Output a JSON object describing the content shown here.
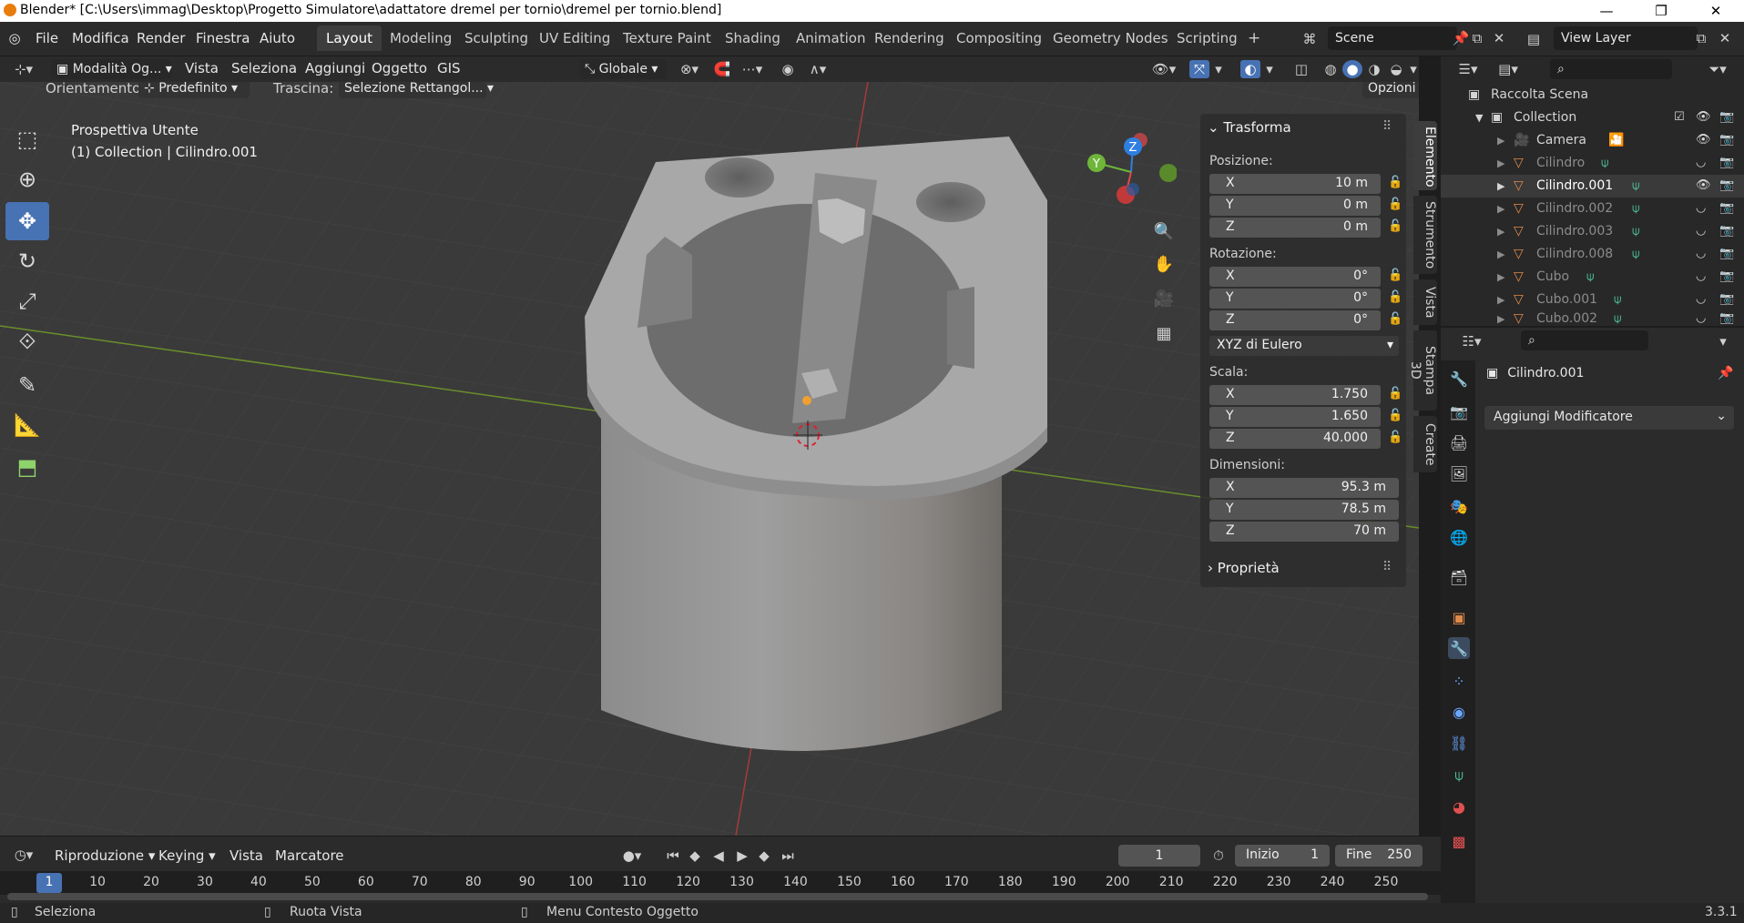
{
  "window": {
    "title": "Blender* [C:\\Users\\immag\\Desktop\\Progetto Simulatore\\adattatore dremel per tornio\\dremel per tornio.blend]",
    "minimize": "—",
    "maximize": "❐",
    "close": "✕"
  },
  "menus": [
    "File",
    "Modifica",
    "Render",
    "Finestra",
    "Aiuto"
  ],
  "workspaces": [
    "Layout",
    "Modeling",
    "Sculpting",
    "UV Editing",
    "Texture Paint",
    "Shading",
    "Animation",
    "Rendering",
    "Compositing",
    "Geometry Nodes",
    "Scripting"
  ],
  "workspace_add": "+",
  "scene": {
    "name": "Scene",
    "view_layer": "View Layer"
  },
  "viewport_header": {
    "mode": "Modalità Og...",
    "items": [
      "Vista",
      "Seleziona",
      "Aggiungi",
      "Oggetto",
      "GIS"
    ],
    "transform_orientation": "Globale"
  },
  "tool_settings": {
    "orient_label": "Orientamento:",
    "orient_value": "Predefinito",
    "drag_label": "Trascina:",
    "drag_value": "Selezione Rettangol...",
    "options": "Opzioni"
  },
  "viewport_info": {
    "line1": "Prospettiva Utente",
    "line2": "(1) Collection | Cilindro.001"
  },
  "gizmo": {
    "x": "X",
    "y": "Y",
    "z": "Z"
  },
  "npanel": {
    "header": "Trasforma",
    "location_label": "Posizione:",
    "location": [
      {
        "axis": "X",
        "value": "10 m"
      },
      {
        "axis": "Y",
        "value": "0 m"
      },
      {
        "axis": "Z",
        "value": "0 m"
      }
    ],
    "rotation_label": "Rotazione:",
    "rotation": [
      {
        "axis": "X",
        "value": "0°"
      },
      {
        "axis": "Y",
        "value": "0°"
      },
      {
        "axis": "Z",
        "value": "0°"
      }
    ],
    "rotation_mode": "XYZ di Eulero",
    "scale_label": "Scala:",
    "scale": [
      {
        "axis": "X",
        "value": "1.750"
      },
      {
        "axis": "Y",
        "value": "1.650"
      },
      {
        "axis": "Z",
        "value": "40.000"
      }
    ],
    "dimensions_label": "Dimensioni:",
    "dimensions": [
      {
        "axis": "X",
        "value": "95.3 m"
      },
      {
        "axis": "Y",
        "value": "78.5 m"
      },
      {
        "axis": "Z",
        "value": "70 m"
      }
    ],
    "properties": "Proprietà"
  },
  "side_tabs": [
    "Elemento",
    "Strumento",
    "Vista",
    "Stampa 3D",
    "Create"
  ],
  "outliner": {
    "root": "Raccolta Scena",
    "collection": "Collection",
    "items": [
      "Camera",
      "Cilindro",
      "Cilindro.001",
      "Cilindro.002",
      "Cilindro.003",
      "Cilindro.008",
      "Cubo",
      "Cubo.001",
      "Cubo.002"
    ]
  },
  "properties": {
    "object_name": "Cilindro.001",
    "add_modifier": "Aggiungi Modificatore"
  },
  "timeline": {
    "menus": [
      "Riproduzione",
      "Keying",
      "Vista",
      "Marcatore"
    ],
    "current_frame": "1",
    "start_label": "Inizio",
    "start": "1",
    "end_label": "Fine",
    "end": "250",
    "ticks": [
      "1",
      "10",
      "20",
      "30",
      "40",
      "50",
      "60",
      "70",
      "80",
      "90",
      "100",
      "110",
      "120",
      "130",
      "140",
      "150",
      "160",
      "170",
      "180",
      "190",
      "200",
      "210",
      "220",
      "230",
      "240",
      "250"
    ]
  },
  "status": {
    "select": "Seleziona",
    "rotate": "Ruota Vista",
    "context": "Menu Contesto Oggetto",
    "version": "3.3.1"
  },
  "colors": {
    "accent": "#4772b3",
    "x_axis": "#e04949",
    "y_axis": "#6eb53a",
    "z_axis": "#2e7fe0"
  }
}
